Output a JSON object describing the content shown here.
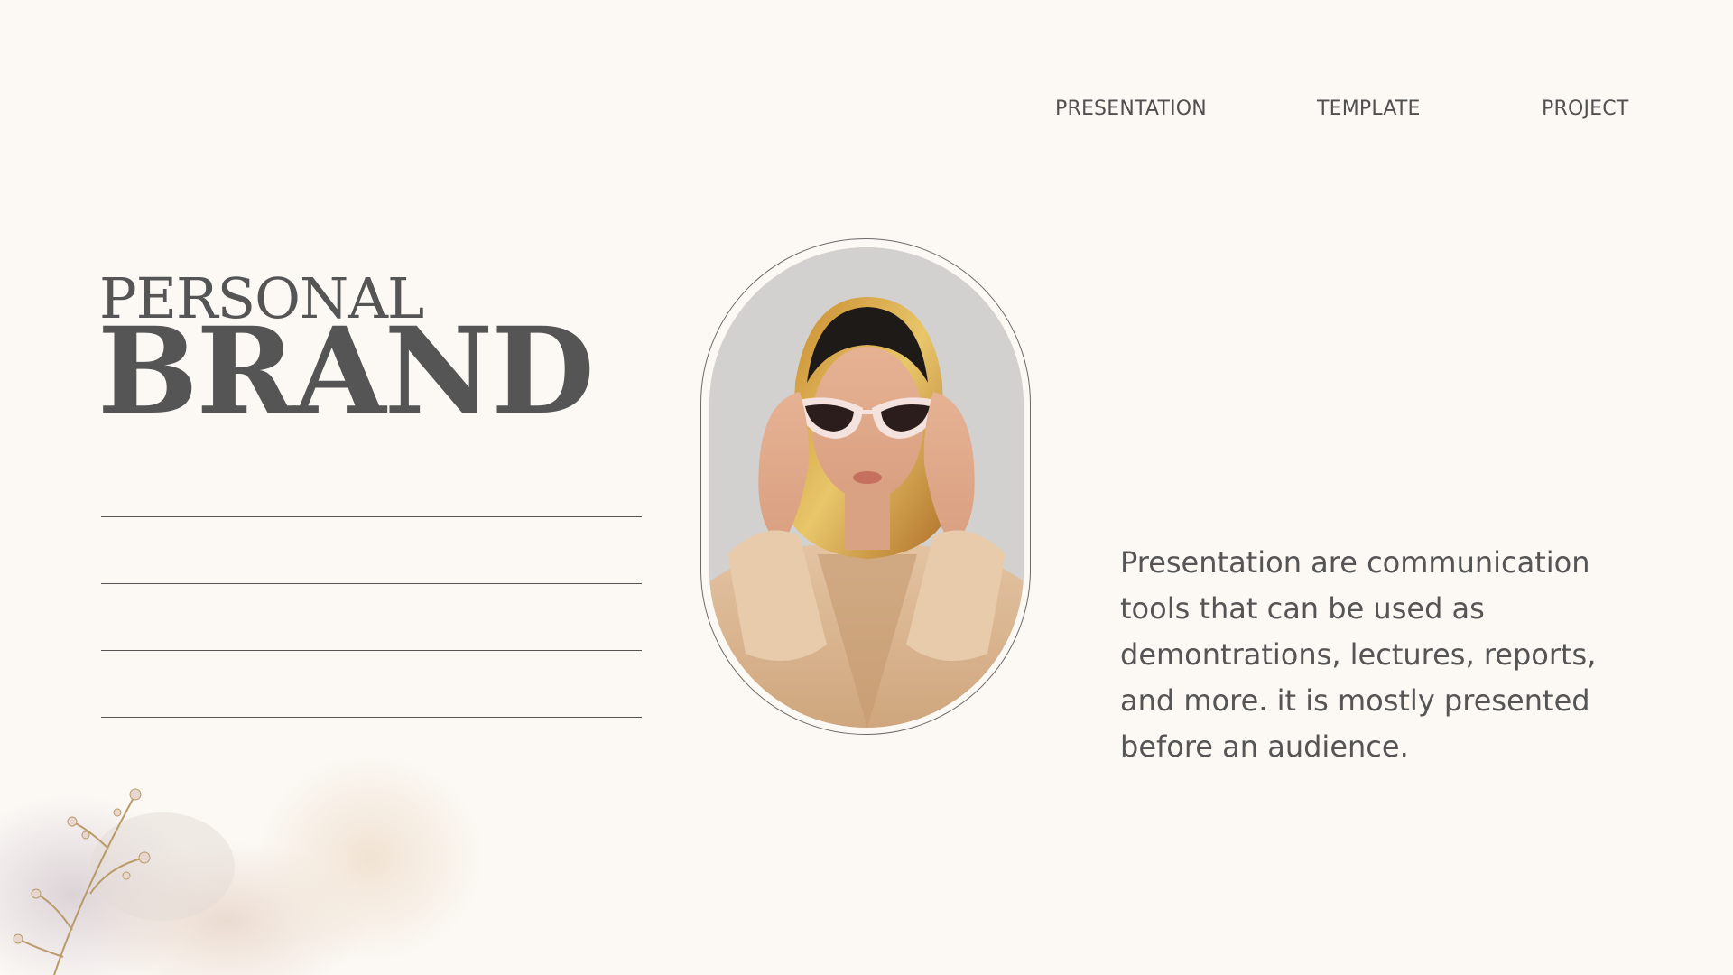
{
  "nav": {
    "items": [
      "PRESENTATION",
      "TEMPLATE",
      "PROJECT"
    ]
  },
  "title": {
    "line1": "PERSONAL",
    "line2": "BRAND"
  },
  "body": {
    "text": "Presentation are communication tools that can be used as demontrations, lectures, reports, and more. it is mostly presented before an audience."
  },
  "colors": {
    "background": "#fcf9f5",
    "text": "#555555"
  }
}
